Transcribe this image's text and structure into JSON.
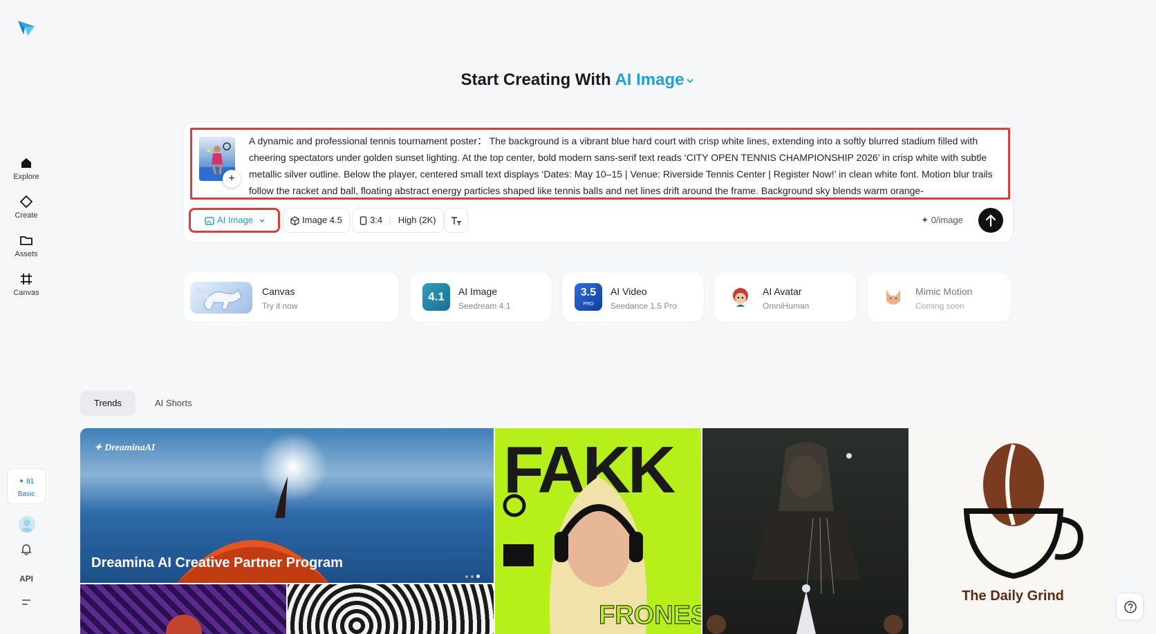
{
  "sidebar": {
    "items": [
      {
        "label": "Explore",
        "icon": "home-icon"
      },
      {
        "label": "Create",
        "icon": "diamond-icon"
      },
      {
        "label": "Assets",
        "icon": "folder-icon"
      },
      {
        "label": "Canvas",
        "icon": "grid-icon"
      }
    ],
    "credits": {
      "amount": "✦ 81",
      "plan": "Basic"
    },
    "api_label": "API"
  },
  "heading": {
    "prefix": "Start Creating With",
    "mode": "AI Image"
  },
  "prompt": {
    "text": "A dynamic and professional tennis tournament poster： The background is a vibrant blue hard court with crisp white lines, extending into a softly blurred stadium filled with cheering spectators under golden sunset lighting. At the top center, bold modern sans-serif text reads ‘CITY OPEN TENNIS CHAMPIONSHIP 2026’ in crisp white with subtle metallic silver outline. Below the player, centered small text displays ‘Dates: May 10–15 | Venue: Riverside Tennis Center | Register Now!’ in clean white font. Motion blur trails follow the racket and ball, floating abstract energy particles shaped like tennis balls and net lines drift around the frame. Background sky blends warm orange-"
  },
  "toolbar": {
    "mode_label": "AI Image",
    "model_label": "Image 4.5",
    "ratio_label": "3:4",
    "quality_label": "High (2K)",
    "cost_label": "✦ 0/image"
  },
  "features": [
    {
      "title": "Canvas",
      "subtitle": "Try it now"
    },
    {
      "title": "AI Image",
      "subtitle": "Seedream 4.1",
      "badge": "4.1"
    },
    {
      "title": "AI Video",
      "subtitle": "Seedance 1.5 Pro",
      "badge": "3.5",
      "badge_sub": "PRO"
    },
    {
      "title": "AI Avatar",
      "subtitle": "OmniHuman"
    },
    {
      "title": "Mimic Motion",
      "subtitle": "Coming soon"
    }
  ],
  "tabs": [
    {
      "label": "Trends",
      "active": true
    },
    {
      "label": "AI Shorts",
      "active": false
    }
  ],
  "gallery": {
    "banner_brand": "DreaminaAI",
    "banner_title": "Dreamina AI Creative Partner Program",
    "poster_top_text": "FAKK",
    "poster_bottom_text": "FRONES",
    "coffee_text": "The Daily Grind"
  },
  "colors": {
    "accent": "#1ba3d6",
    "highlight": "#e03c3c",
    "background": "#f6f7f8"
  }
}
